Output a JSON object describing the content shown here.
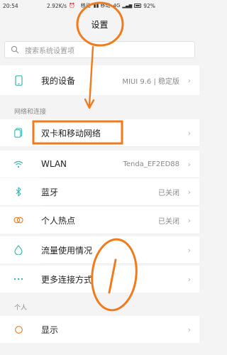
{
  "status_bar": {
    "time": "20:54",
    "net_speed": "2.92K/s",
    "alarm_icon": "alarm-icon",
    "carrier": "移动",
    "mobile_label": "移动",
    "network_type": "4G",
    "battery": "92%"
  },
  "header": {
    "title": "设置"
  },
  "search": {
    "placeholder": "搜索系统设置项"
  },
  "my_device": {
    "label": "我的设备",
    "value": "MIUI 9.6 | 稳定版",
    "icon": "phone-icon"
  },
  "sections": {
    "network": "网络和连接",
    "personal": "个人"
  },
  "network_items": [
    {
      "label": "双卡和移动网络",
      "value": "",
      "icon": "sim-card-icon"
    },
    {
      "label": "WLAN",
      "value": "Tenda_EF2ED88",
      "icon": "wifi-icon"
    },
    {
      "label": "蓝牙",
      "value": "已关闭",
      "icon": "bluetooth-icon"
    },
    {
      "label": "个人热点",
      "value": "已关闭",
      "icon": "hotspot-icon"
    },
    {
      "label": "流量使用情况",
      "value": "",
      "icon": "data-usage-icon"
    },
    {
      "label": "更多连接方式",
      "value": "",
      "icon": "more-icon"
    }
  ],
  "personal_items": [
    {
      "label": "显示",
      "value": "",
      "icon": "display-icon"
    }
  ],
  "colors": {
    "annotation": "#f07b1c",
    "accent_icon": "#35b5b0",
    "background": "#f4f4f4"
  }
}
